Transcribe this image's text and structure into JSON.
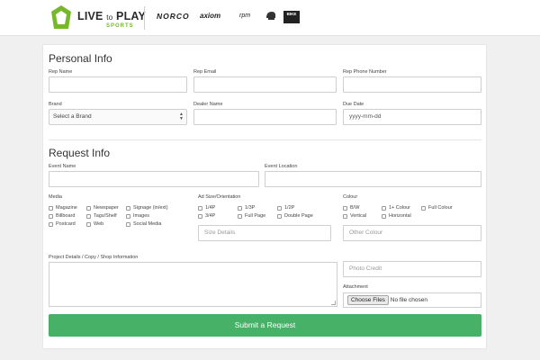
{
  "header": {
    "logo_main": "LIVE",
    "logo_to": "to",
    "logo_play": "PLAY",
    "logo_sub": "SPORTS",
    "brands": [
      "NORCO",
      "axiom",
      "rpm",
      "BIKE"
    ]
  },
  "personal": {
    "title": "Personal Info",
    "rep_name_label": "Rep Name",
    "rep_email_label": "Rep Email",
    "rep_phone_label": "Rep Phone Number",
    "brand_label": "Brand",
    "brand_selected": "Select a Brand",
    "dealer_label": "Dealer Name",
    "due_label": "Due Date",
    "due_placeholder": "yyyy-mm-dd"
  },
  "request": {
    "title": "Request Info",
    "event_name_label": "Event Name",
    "event_location_label": "Event Location",
    "media_label": "Media",
    "media_options": [
      "Magazine",
      "Newspaper",
      "Signage (in/ext)",
      "Billboard",
      "Tags/Shelf",
      "Images",
      "Postcard",
      "Web",
      "Social Media"
    ],
    "ad_size_label": "Ad Size/Orientation",
    "ad_size_options": [
      "1/4P",
      "1/3P",
      "1/2P",
      "3/4P",
      "Full Page",
      "Double Page"
    ],
    "size_details_placeholder": "Size Details",
    "colour_label": "Colour",
    "colour_options": [
      "B/W",
      "1+ Colour",
      "Full Colour",
      "Vertical",
      "Horizontal"
    ],
    "other_colour_placeholder": "Other Colour",
    "project_label": "Project Details / Copy / Shop Information",
    "photo_credit_placeholder": "Photo Credit",
    "attachment_label": "Attachment",
    "choose_files": "Choose Files",
    "no_file": "No file chosen",
    "submit_label": "Submit a Request"
  },
  "colors": {
    "accent": "#47b167",
    "logo_green": "#76b82a"
  }
}
